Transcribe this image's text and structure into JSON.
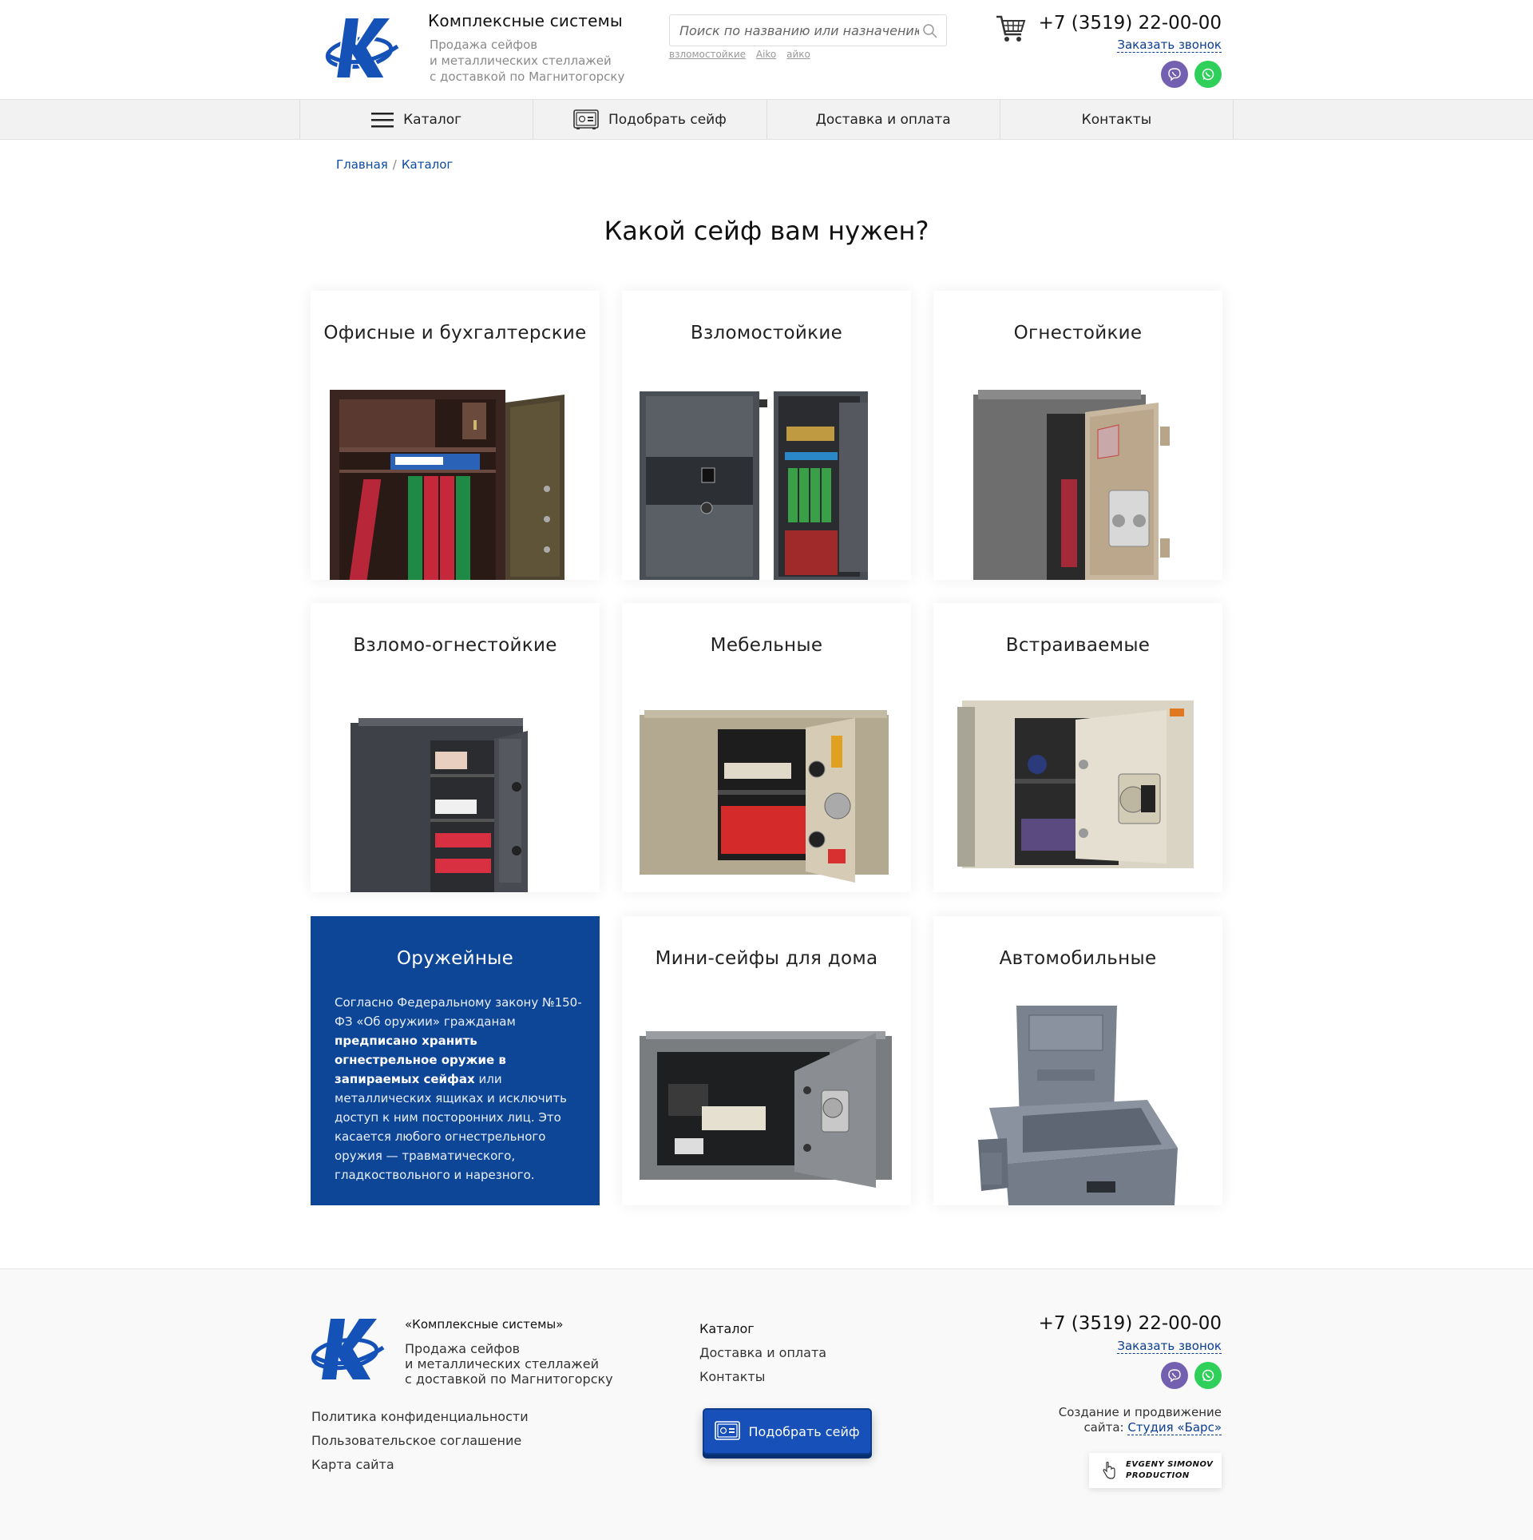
{
  "colors": {
    "brand_blue": "#0d4597",
    "link_blue": "#0b3d91",
    "nav_bg": "#f2f2f2",
    "viber": "#7460b0",
    "whatsapp": "#2ed05a"
  },
  "header": {
    "brand_title": "Комплексные системы",
    "brand_sub_1": "Продажа сейфов",
    "brand_sub_2": "и металлических стеллажей",
    "brand_sub_3": "с доставкой по Магнитогорску",
    "search_placeholder": "Поиск по названию или назначению",
    "search_tags": [
      "взломостойкие",
      "Aiko",
      "айко"
    ],
    "phone": "+7 (3519) 22-00-00",
    "callback_label": "Заказать звонок",
    "icons": [
      "logo-k-icon",
      "search-icon",
      "cart-icon",
      "viber-icon",
      "whatsapp-icon"
    ]
  },
  "nav": {
    "items": [
      {
        "label": "Каталог",
        "icon": "hamburger-icon"
      },
      {
        "label": "Подобрать сейф",
        "icon": "safe-icon"
      },
      {
        "label": "Доставка и оплата"
      },
      {
        "label": "Контакты"
      }
    ]
  },
  "breadcrumb": {
    "items": [
      "Главная",
      "Каталог"
    ],
    "separator": "/"
  },
  "main": {
    "title": "Какой сейф вам нужен?",
    "categories": [
      {
        "title": "Офисные и бухгалтерские"
      },
      {
        "title": "Взломостойкие"
      },
      {
        "title": "Огнестойкие"
      },
      {
        "title": "Взломо-огнестойкие"
      },
      {
        "title": "Мебельные"
      },
      {
        "title": "Встраиваемые"
      },
      {
        "title": "Оружейные",
        "text_1": "Согласно Федеральному закону №150-ФЗ «Об оружии» гражданам ",
        "text_bold": "предписано хранить огнестрельное оружие в запираемых сейфах",
        "text_2": " или металлических ящиках и исключить доступ к ним посторонних лиц. Это касается любого огнестрельного оружия — травматического, гладкоствольного и нарезного."
      },
      {
        "title": "Мини-сейфы для дома"
      },
      {
        "title": "Автомобильные"
      }
    ]
  },
  "footer": {
    "company": "«Комплексные системы»",
    "desc_1": "Продажа сейфов",
    "desc_2": "и металлических стеллажей",
    "desc_3": "с доставкой по Магнитогорску",
    "links": [
      "Политика конфиденциальности",
      "Пользовательское соглашение",
      "Карта сайта"
    ],
    "menu": [
      "Каталог",
      "Доставка и оплата",
      "Контакты"
    ],
    "button_label": "Подобрать сейф",
    "phone": "+7 (3519) 22-00-00",
    "callback_label": "Заказать звонок",
    "credit_text_1": "Создание и продвижение",
    "credit_text_2": "сайта: ",
    "credit_link": "Студия «Барс»",
    "badge_line_1": "EVGENY SIMONOV",
    "badge_line_2": "PRODUCTION"
  }
}
